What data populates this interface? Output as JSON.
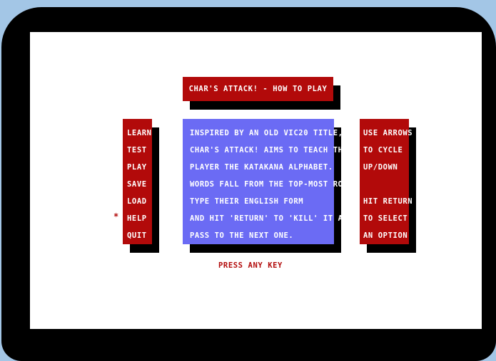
{
  "colors": {
    "background": "#a3c6e6",
    "bezel": "#000000",
    "screen": "#ffffff",
    "panel_red": "#b20a0a",
    "panel_blue": "#6b6bf4",
    "text": "#ffffff"
  },
  "title": "CHAR'S ATTACK! - HOW TO PLAY",
  "menu": {
    "items": [
      "LEARN",
      "TEST",
      "PLAY",
      "SAVE",
      "LOAD",
      "HELP",
      "QUIT"
    ],
    "selected_index": 5,
    "cursor_glyph": "*"
  },
  "description": {
    "lines": [
      "INSPIRED BY AN OLD VIC20 TITLE,",
      "CHAR'S ATTACK! AIMS TO TEACH THE",
      "PLAYER THE KATAKANA ALPHABET.",
      "WORDS FALL FROM THE TOP-MOST ROW;",
      "TYPE THEIR ENGLISH FORM",
      "AND HIT 'RETURN' TO 'KILL' IT AND",
      "PASS TO THE NEXT ONE."
    ]
  },
  "help": {
    "lines": [
      "USE ARROWS",
      "TO CYCLE",
      "UP/DOWN",
      "",
      "HIT RETURN",
      "TO SELECT",
      "AN OPTION"
    ]
  },
  "prompt": "PRESS ANY KEY"
}
